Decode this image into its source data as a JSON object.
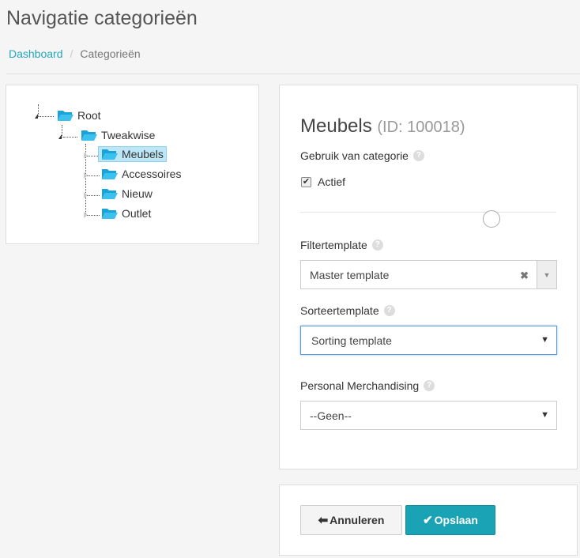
{
  "page": {
    "title": "Navigatie categorieën"
  },
  "breadcrumb": {
    "home": "Dashboard",
    "separator": "/",
    "current": "Categorieën"
  },
  "tree": {
    "root": "Root",
    "child": "Tweakwise",
    "items": [
      "Meubels",
      "Accessoires",
      "Nieuw",
      "Outlet"
    ],
    "selected": "Meubels",
    "folder_color": "#1aa3d9"
  },
  "form": {
    "name": "Meubels",
    "id_label": "(ID: 100018)",
    "usage_label": "Gebruik van categorie",
    "active_label": "Actief",
    "active_checked": true,
    "filter_label": "Filtertemplate",
    "filter_value": "Master template",
    "sort_label": "Sorteertemplate",
    "sort_value": "Sorting template",
    "personal_label": "Personal Merchandising",
    "personal_value": "--Geen--",
    "help_glyph": "?"
  },
  "buttons": {
    "cancel": "Annuleren",
    "save": "Opslaan"
  },
  "colors": {
    "accent": "#1aa3b4",
    "link": "#23a6c0"
  }
}
